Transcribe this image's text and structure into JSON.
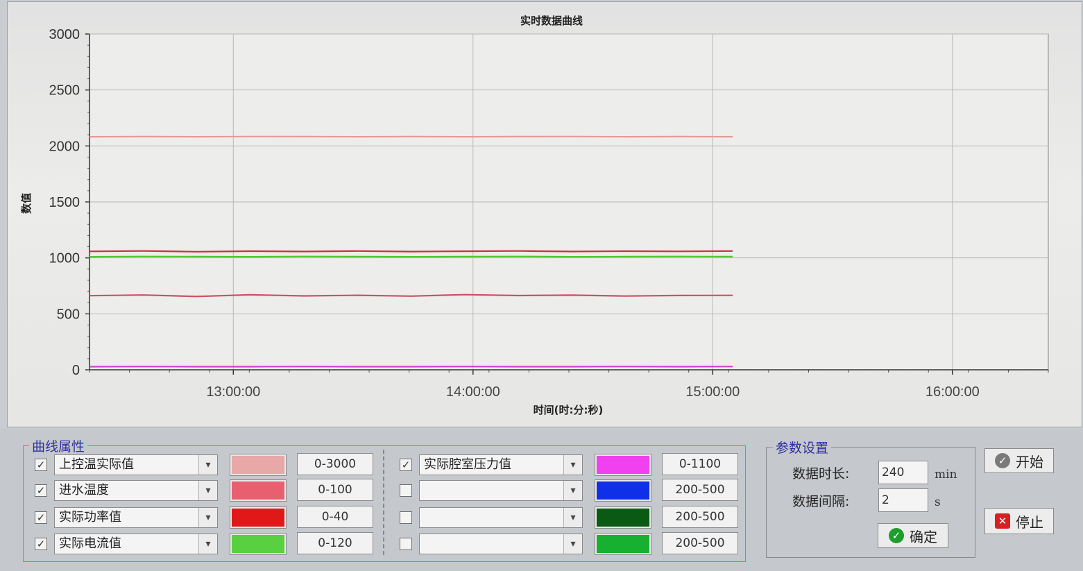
{
  "chart_data": {
    "type": "line",
    "title": "实时数据曲线",
    "xlabel": "时间(时:分:秒)",
    "ylabel": "数值",
    "x_tick_labels": [
      "13:00:00",
      "14:00:00",
      "15:00:00",
      "16:00:00"
    ],
    "x_ticks_minutes": [
      780,
      840,
      900,
      960
    ],
    "xlim_minutes": [
      744,
      984
    ],
    "y_ticks": [
      0,
      500,
      1000,
      1500,
      2000,
      2500,
      3000
    ],
    "ylim": [
      0,
      3000
    ],
    "grid": true,
    "x_start": "12:24:00",
    "x_end": "15:05:00",
    "series": [
      {
        "color": "#e89a9a",
        "values": [
          2082,
          2083,
          2082,
          2084,
          2083,
          2082,
          2083,
          2082,
          2083,
          2084,
          2082,
          2083,
          2082
        ]
      },
      {
        "color": "#c83040",
        "values": [
          1058,
          1062,
          1055,
          1060,
          1057,
          1061,
          1056,
          1059,
          1062,
          1057,
          1060,
          1058,
          1061
        ]
      },
      {
        "color": "#50c830",
        "values": [
          1010,
          1012,
          1011,
          1010,
          1012,
          1011,
          1010,
          1011,
          1012,
          1010,
          1011,
          1012,
          1011
        ]
      },
      {
        "color": "#d05060",
        "values": [
          662,
          668,
          655,
          670,
          660,
          666,
          658,
          671,
          663,
          667,
          659,
          664,
          665
        ]
      },
      {
        "color": "#d040d0",
        "values": [
          28,
          29,
          28,
          28,
          29,
          28,
          28,
          29,
          28,
          28,
          29,
          28,
          29
        ]
      }
    ]
  },
  "curve_props": {
    "title": "曲线属性",
    "left_rows": [
      {
        "checked": "✓",
        "name": "上控温实际值",
        "color": "#e8a8a8",
        "range": "0-3000"
      },
      {
        "checked": "✓",
        "name": "进水温度",
        "color": "#e86070",
        "range": "0-100"
      },
      {
        "checked": "✓",
        "name": "实际功率值",
        "color": "#e01818",
        "range": "0-40"
      },
      {
        "checked": "✓",
        "name": "实际电流值",
        "color": "#58d040",
        "range": "0-120"
      }
    ],
    "right_rows": [
      {
        "checked": "✓",
        "name": "实际腔室压力值",
        "color": "#f040f0",
        "range": "0-1100"
      },
      {
        "checked": "",
        "name": "",
        "color": "#1030e8",
        "range": "200-500"
      },
      {
        "checked": "",
        "name": "",
        "color": "#0a5a14",
        "range": "200-500"
      },
      {
        "checked": "",
        "name": "",
        "color": "#18b030",
        "range": "200-500"
      }
    ],
    "dropdown_icon": "chevron-down-icon"
  },
  "params": {
    "title": "参数设置",
    "duration_label": "数据时长:",
    "duration_value": "240",
    "duration_unit": "min",
    "interval_label": "数据间隔:",
    "interval_value": "2",
    "interval_unit": "s",
    "confirm_label": "确定"
  },
  "buttons": {
    "start_label": "开始",
    "stop_label": "停止"
  }
}
